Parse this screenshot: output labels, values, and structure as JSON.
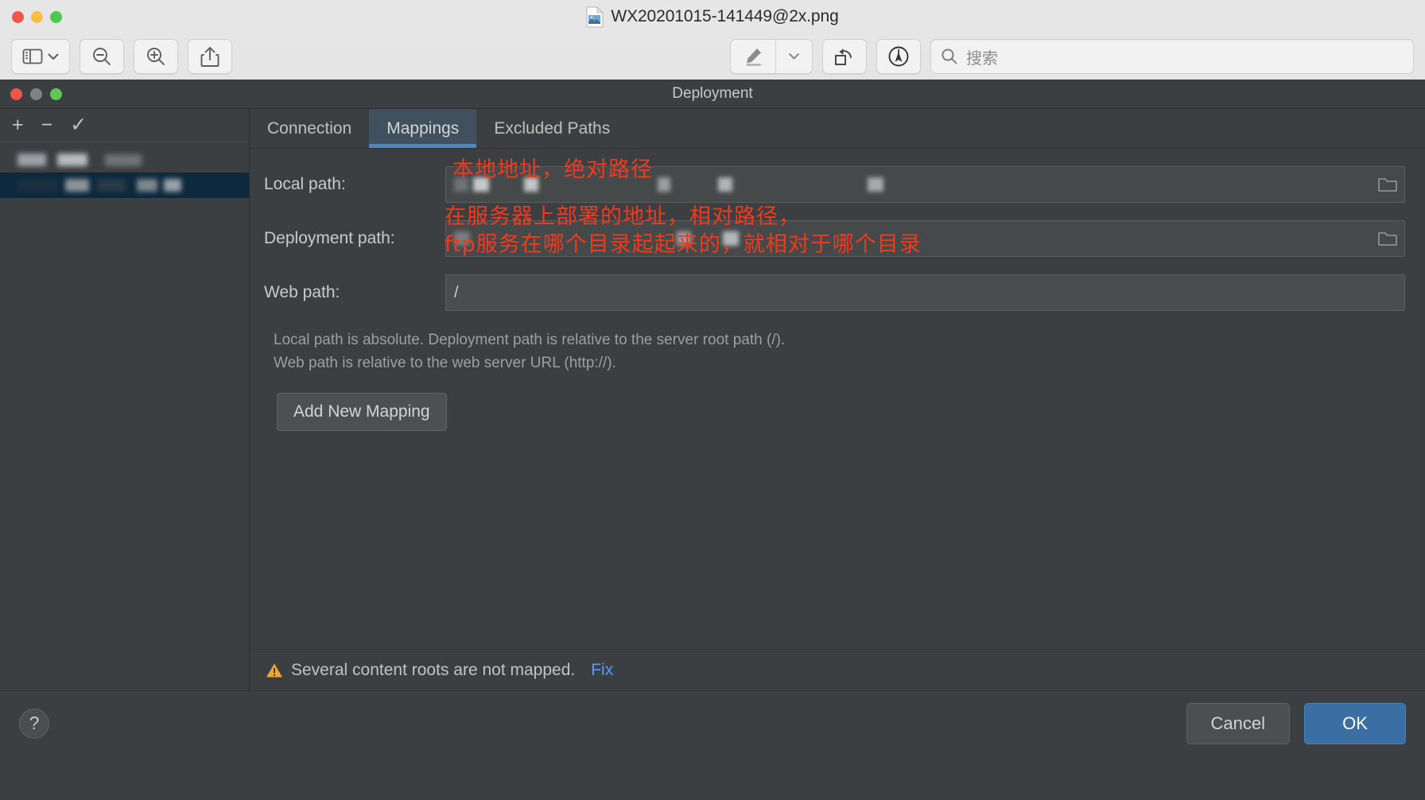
{
  "preview_window": {
    "title": "WX20201015-141449@2x.png",
    "traffic_lights": [
      "close",
      "minimize",
      "zoom"
    ],
    "toolbar": {
      "sidebar_button": "sidebar-view",
      "zoom_out_button": "zoom-out",
      "zoom_in_button": "zoom-in",
      "share_button": "share",
      "markup_button": "markup-highlighter",
      "markup_dropdown": "markup-options",
      "rotate_button": "rotate-left",
      "annotate_button": "annotate",
      "search_placeholder": "搜索"
    }
  },
  "dialog": {
    "title": "Deployment",
    "traffic_lights": [
      "close",
      "minimize-disabled",
      "zoom"
    ],
    "server_panel": {
      "toolbar": {
        "add": "+",
        "remove": "−",
        "set_default": "✓"
      },
      "items": [
        {
          "redacted": true,
          "selected": false
        },
        {
          "redacted": true,
          "selected": true
        }
      ]
    },
    "tabs": [
      {
        "label": "Connection",
        "active": false
      },
      {
        "label": "Mappings",
        "active": true
      },
      {
        "label": "Excluded Paths",
        "active": false
      }
    ],
    "fields": [
      {
        "label": "Local path:",
        "value": "",
        "redacted": true,
        "has_browse": true
      },
      {
        "label": "Deployment path:",
        "value": "",
        "redacted": true,
        "has_browse": true
      },
      {
        "label": "Web path:",
        "value": "/",
        "redacted": false,
        "has_browse": false
      }
    ],
    "hint_lines": [
      "Local path is absolute. Deployment path is relative to the server root path (/).",
      "Web path is relative to the web server URL (http://)."
    ],
    "add_mapping_button": "Add New Mapping",
    "warning": {
      "icon": "warning-triangle",
      "text": "Several content roots are not mapped.",
      "link": "Fix"
    },
    "footer": {
      "help": "?",
      "cancel": "Cancel",
      "ok": "OK"
    }
  },
  "annotations": {
    "local_path": "本地地址，绝对路径",
    "deployment_path_line1": "在服务器上部署的地址，相对路径，",
    "deployment_path_line2": "ftp服务在哪个目录起起来的，就相对于哪个目录"
  },
  "colors": {
    "annotation_red": "#f03a1e",
    "tab_accent_blue": "#4a88c7",
    "ok_button_blue": "#3b6ea3",
    "fix_link_blue": "#589df6",
    "selected_row_blue": "#0d293e",
    "warning_orange": "#f0a732",
    "dialog_bg": "#3c3f41"
  }
}
